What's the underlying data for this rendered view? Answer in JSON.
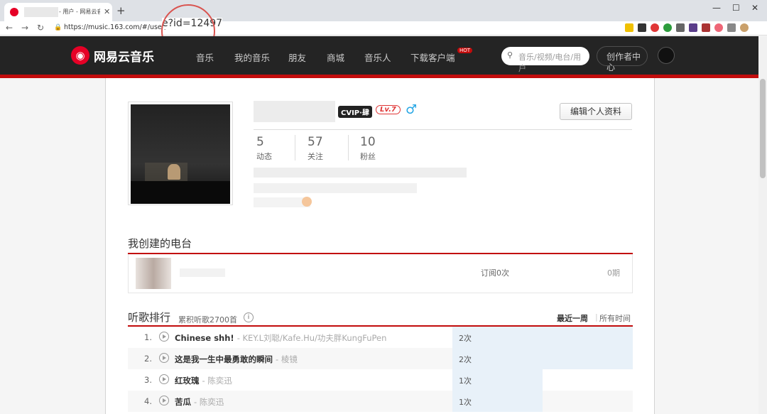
{
  "browser": {
    "tab_title": "- 用户 - 网易云音",
    "url": "https://music.163.com/#/user/ho",
    "url_zoom": "e?id=12497"
  },
  "header": {
    "logo": "网易云音乐",
    "nav": [
      "音乐",
      "我的音乐",
      "朋友",
      "商城",
      "音乐人",
      "下载客户端"
    ],
    "hot_badge": "HOT",
    "search_placeholder": "音乐/视频/电台/用户",
    "creator": "创作者中心"
  },
  "profile": {
    "vip": "CVIP·肆",
    "level": "Lv.7",
    "edit_button": "编辑个人资料",
    "stats": [
      {
        "num": "5",
        "label": "动态"
      },
      {
        "num": "57",
        "label": "关注"
      },
      {
        "num": "10",
        "label": "粉丝"
      }
    ]
  },
  "radio": {
    "title": "我创建的电台",
    "subs": "订阅0次",
    "eps": "0期"
  },
  "ranking": {
    "title": "听歌排行",
    "total": "累积听歌2700首",
    "tab_week": "最近一周",
    "tab_all": "所有时间",
    "rows": [
      {
        "idx": "1.",
        "song": "Chinese shh!",
        "artist": "- KEY.L刘聪/Kafe.Hu/功夫胖KungFuPen",
        "times": "2次",
        "ratio": 1.0
      },
      {
        "idx": "2.",
        "song": "这是我一生中最勇敢的瞬间",
        "artist": "- 棱镜",
        "times": "2次",
        "ratio": 1.0
      },
      {
        "idx": "3.",
        "song": "红玫瑰",
        "artist": "- 陈奕迅",
        "times": "1次",
        "ratio": 0.5
      },
      {
        "idx": "4.",
        "song": "苦瓜",
        "artist": "- 陈奕迅",
        "times": "1次",
        "ratio": 0.5
      }
    ]
  }
}
